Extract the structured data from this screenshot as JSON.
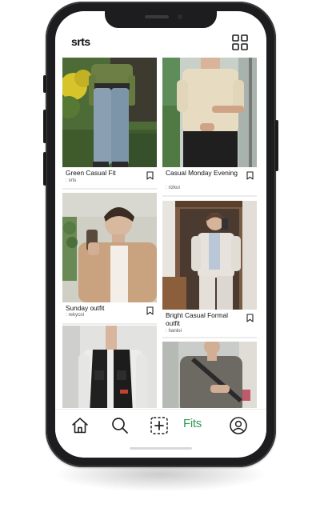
{
  "app": {
    "brand": "srts"
  },
  "feed": {
    "posts": [
      {
        "title": "Green Casual Fit",
        "author": ": srts"
      },
      {
        "title": "Casual Monday Evening",
        "author": ": rizkoi"
      },
      {
        "title": "Sunday outfit",
        "author": ": rekycoi"
      },
      {
        "title": "Bright Casual Formal outfit",
        "author": ": hanloi"
      }
    ]
  },
  "tabbar": {
    "fits_label": "Fits",
    "active_color": "#2f9a55",
    "icons": [
      "home-icon",
      "search-icon",
      "add-post-icon",
      "fits-tab",
      "profile-icon"
    ]
  },
  "colors": {
    "accent": "#2f9a55",
    "phone_frame": "#1d1d1f"
  }
}
